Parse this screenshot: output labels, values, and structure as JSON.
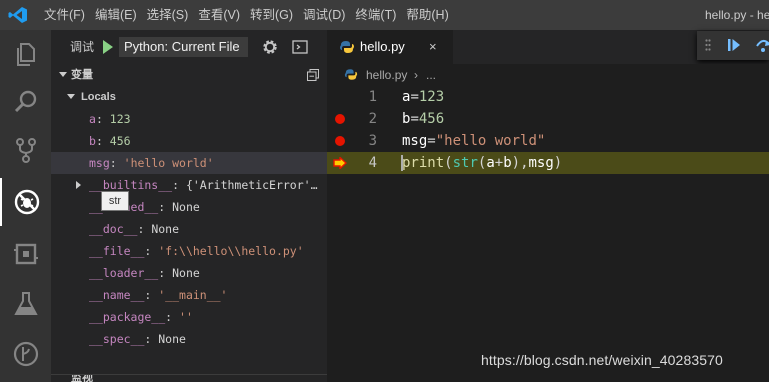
{
  "menu": [
    "文件(F)",
    "编辑(E)",
    "选择(S)",
    "查看(V)",
    "转到(G)",
    "调试(D)",
    "终端(T)",
    "帮助(H)"
  ],
  "window_title": "hello.py - he",
  "activity_icons": [
    "explorer-icon",
    "search-icon",
    "source-control-icon",
    "debug-icon",
    "extensions-icon",
    "test-icon",
    "git-branch-icon"
  ],
  "debug": {
    "label": "调试",
    "config": "Python: Current File"
  },
  "variables": {
    "title": "变量",
    "scope": "Locals",
    "items": [
      {
        "name": "a",
        "value": "123",
        "kind": "num"
      },
      {
        "name": "b",
        "value": "456",
        "kind": "num"
      },
      {
        "name": "msg",
        "value": "'hello world'",
        "kind": "str"
      },
      {
        "name": "__builtins__",
        "value": "{'ArithmeticError'…",
        "kind": "plain",
        "expandable": true
      },
      {
        "name": "__cached__",
        "value": "None",
        "kind": "plain"
      },
      {
        "name": "__doc__",
        "value": "None",
        "kind": "plain"
      },
      {
        "name": "__file__",
        "value": "'f:\\\\hello\\\\hello.py'",
        "kind": "str"
      },
      {
        "name": "__loader__",
        "value": "None",
        "kind": "plain"
      },
      {
        "name": "__name__",
        "value": "'__main__'",
        "kind": "str"
      },
      {
        "name": "__package__",
        "value": "''",
        "kind": "str"
      },
      {
        "name": "__spec__",
        "value": "None",
        "kind": "plain"
      }
    ],
    "tooltip": "str",
    "next_section": "监视"
  },
  "editor": {
    "tab_label": "hello.py",
    "tab_close": "×",
    "breadcrumb_file": "hello.py",
    "breadcrumb_sep": "›",
    "breadcrumb_more": "...",
    "lines": [
      {
        "num": "1",
        "breakpoint": "none",
        "tokens": [
          [
            "a",
            "var"
          ],
          [
            "=",
            "op"
          ],
          [
            "123",
            "num"
          ]
        ]
      },
      {
        "num": "2",
        "breakpoint": "dot",
        "tokens": [
          [
            "b",
            "var"
          ],
          [
            "=",
            "op"
          ],
          [
            "456",
            "num"
          ]
        ]
      },
      {
        "num": "3",
        "breakpoint": "dot",
        "tokens": [
          [
            "msg",
            "var"
          ],
          [
            "=",
            "op"
          ],
          [
            "\"hello world\"",
            "str"
          ]
        ]
      },
      {
        "num": "4",
        "breakpoint": "current",
        "tokens": [
          [
            "print",
            "fn"
          ],
          [
            "(",
            "punc"
          ],
          [
            "str",
            "builtin"
          ],
          [
            "(",
            "punc"
          ],
          [
            "a",
            "var"
          ],
          [
            "+",
            "op"
          ],
          [
            "b",
            "var"
          ],
          [
            "),",
            "punc"
          ],
          [
            "msg",
            "var"
          ],
          [
            ")",
            "punc"
          ]
        ]
      }
    ]
  },
  "watermark": "https://blog.csdn.net/weixin_40283570",
  "colors": {
    "titlebar": "#3c3c3c",
    "activitybar": "#333333",
    "sidebar": "#252526",
    "editor": "#1e1e1e",
    "current_line": "#4b4b18",
    "breakpoint": "#e51400"
  }
}
